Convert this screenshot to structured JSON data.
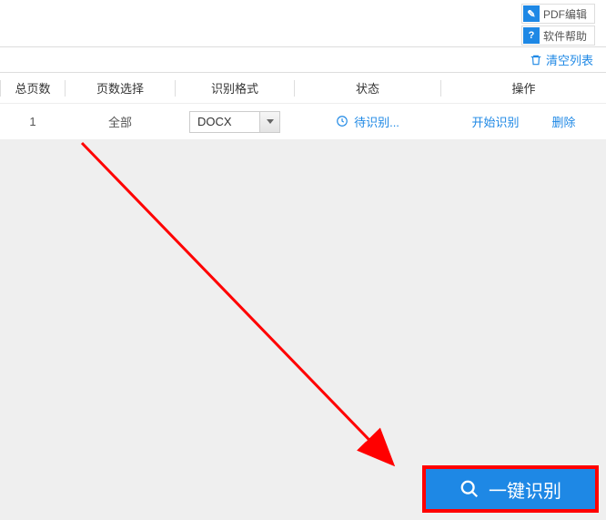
{
  "top_links": {
    "pdf_edit": {
      "icon": "✎",
      "label": "PDF编辑"
    },
    "help": {
      "icon": "?",
      "label": "软件帮助"
    }
  },
  "toolbar": {
    "clear_list": "清空列表"
  },
  "table": {
    "headers": {
      "pages": "总页数",
      "select": "页数选择",
      "format": "识别格式",
      "status": "状态",
      "action": "操作"
    },
    "rows": [
      {
        "pages": "1",
        "select": "全部",
        "format": "DOCX",
        "status": "待识别...",
        "action_start": "开始识别",
        "action_delete": "删除"
      }
    ]
  },
  "footer": {
    "recognize_btn": "一键识别"
  }
}
